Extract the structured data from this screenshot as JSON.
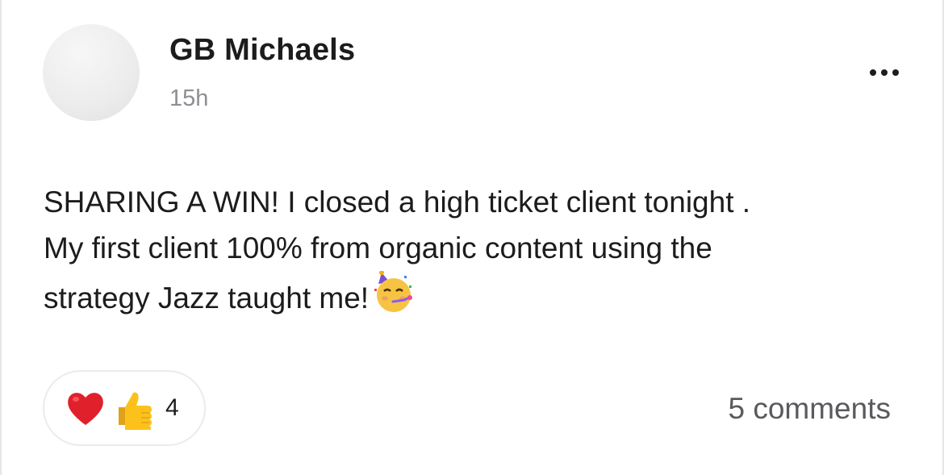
{
  "post": {
    "author": "GB Michaels",
    "timestamp": "15h",
    "text": "SHARING A WIN! I closed a high ticket client tonight .\nMy first client 100% from organic content using the\nstrategy Jazz taught me!",
    "inline_emoji": "partying-face-emoji"
  },
  "menu": {
    "icon": "more-horizontal-icon"
  },
  "reactions": {
    "icons": [
      "red-heart-emoji",
      "thumbs-up-emoji"
    ],
    "count": "4"
  },
  "comments": {
    "label": "5 comments"
  },
  "colors": {
    "text_primary": "#1c1c1e",
    "text_secondary": "#8e8e93",
    "border": "#ebebeb",
    "avatar_placeholder": "#ececec"
  }
}
